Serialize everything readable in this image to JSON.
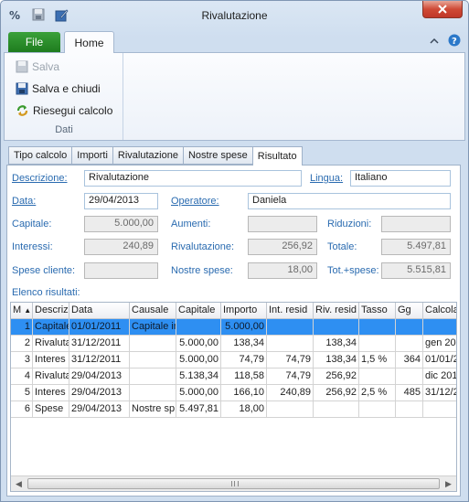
{
  "window": {
    "title": "Rivalutazione"
  },
  "ribbon": {
    "file_tab": "File",
    "home_tab": "Home",
    "buttons": {
      "salva": "Salva",
      "salva_chiudi": "Salva e chiudi",
      "riesegui": "Riesegui calcolo"
    },
    "group_label": "Dati"
  },
  "tabs": [
    "Tipo calcolo",
    "Importi",
    "Rivalutazione",
    "Nostre spese",
    "Risultato"
  ],
  "form": {
    "descrizione_label": "Descrizione:",
    "descrizione": "Rivalutazione",
    "lingua_label": "Lingua:",
    "lingua": "Italiano",
    "data_label": "Data:",
    "data": "29/04/2013",
    "operatore_label": "Operatore:",
    "operatore": "Daniela",
    "capitale_label": "Capitale:",
    "capitale": "5.000,00",
    "aumenti_label": "Aumenti:",
    "aumenti": "",
    "riduzioni_label": "Riduzioni:",
    "riduzioni": "",
    "interessi_label": "Interessi:",
    "interessi": "240,89",
    "rivalutazione_label": "Rivalutazione:",
    "rivalutazione": "256,92",
    "totale_label": "Totale:",
    "totale": "5.497,81",
    "spese_cliente_label": "Spese cliente:",
    "spese_cliente": "",
    "nostre_spese_label": "Nostre spese:",
    "nostre_spese": "18,00",
    "tot_spese_label": "Tot.+spese:",
    "tot_spese": "5.515,81"
  },
  "results": {
    "label": "Elenco risultati:",
    "columns": [
      "M",
      "Descrizi",
      "Data",
      "Causale",
      "Capitale",
      "Importo",
      "Int. resid",
      "Riv. resid",
      "Tasso",
      "Gg",
      "Calcola"
    ],
    "sort_indicator": "▲",
    "rows": [
      [
        "1",
        "Capitale",
        "01/01/2011",
        "Capitale in",
        "",
        "5.000,00",
        "",
        "",
        "",
        "",
        ""
      ],
      [
        "2",
        "Rivaluta",
        "31/12/2011",
        "",
        "5.000,00",
        "138,34",
        "",
        "138,34",
        "",
        "",
        "gen 20"
      ],
      [
        "3",
        "Interes",
        "31/12/2011",
        "",
        "5.000,00",
        "74,79",
        "74,79",
        "138,34",
        "1,5  %",
        "364",
        "01/01/2"
      ],
      [
        "4",
        "Rivaluta",
        "29/04/2013",
        "",
        "5.138,34",
        "118,58",
        "74,79",
        "256,92",
        "",
        "",
        "dic 201"
      ],
      [
        "5",
        "Interes",
        "29/04/2013",
        "",
        "5.000,00",
        "166,10",
        "240,89",
        "256,92",
        "2,5  %",
        "485",
        "31/12/2"
      ],
      [
        "6",
        "Spese",
        "29/04/2013",
        "Nostre sp",
        "5.497,81",
        "18,00",
        "",
        "",
        "",
        "",
        ""
      ]
    ]
  },
  "colors": {
    "file_tab": "#2a8f2a",
    "selection": "#2e8ff2",
    "label": "#2a6bb0",
    "close": "#c9402f"
  }
}
